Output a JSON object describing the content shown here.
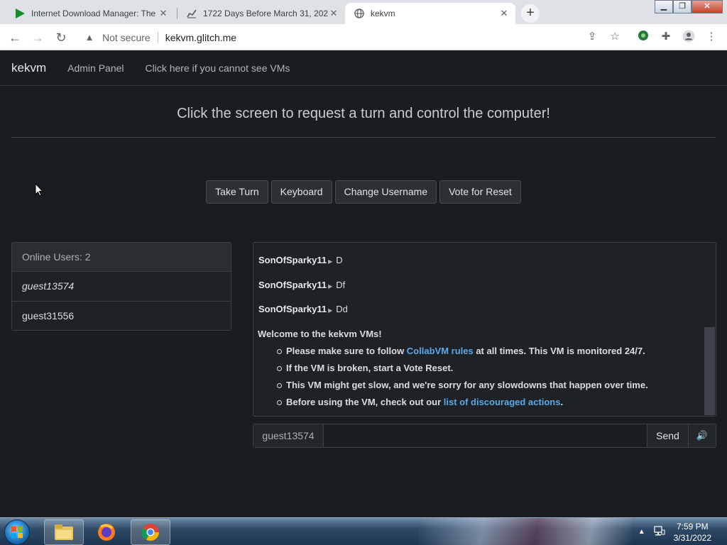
{
  "browser": {
    "tabs": [
      {
        "title": "Internet Download Manager: The",
        "icon": "idm-play-icon",
        "active": false
      },
      {
        "title": "1722 Days Before March 31, 202",
        "icon": "chart-icon",
        "active": false
      },
      {
        "title": "kekvm",
        "icon": "globe-icon",
        "active": true
      }
    ],
    "address": {
      "security": "Not secure",
      "url": "kekvm.glitch.me"
    }
  },
  "nav": {
    "brand": "kekvm",
    "links": [
      "Admin Panel",
      "Click here if you cannot see VMs"
    ]
  },
  "headline": "Click the screen to request a turn and control the computer!",
  "buttons": [
    "Take Turn",
    "Keyboard",
    "Change Username",
    "Vote for Reset"
  ],
  "users": {
    "header": "Online Users: 2",
    "list": [
      "guest13574",
      "guest31556"
    ]
  },
  "chat": {
    "messages": [
      {
        "user": "SonOfSparky11",
        "text": "D"
      },
      {
        "user": "SonOfSparky11",
        "text": "Df"
      },
      {
        "user": "SonOfSparky11",
        "text": "Dd"
      }
    ],
    "welcome_title": "Welcome to the kekvm VMs!",
    "rules": [
      {
        "pre": "Please make sure to follow ",
        "link": "CollabVM rules",
        "post": " at all times. This VM is monitored 24/7."
      },
      {
        "pre": "If the VM is broken, start a Vote Reset.",
        "link": "",
        "post": ""
      },
      {
        "pre": "This VM might get slow, and we're sorry for any slowdowns that happen over time.",
        "link": "",
        "post": ""
      },
      {
        "pre": "Before using the VM, check out our ",
        "link": "list of discouraged actions",
        "post": "."
      }
    ]
  },
  "input": {
    "username": "guest13574",
    "value": "",
    "send_label": "Send"
  },
  "taskbar": {
    "time": "7:59 PM",
    "date": "3/31/2022"
  }
}
